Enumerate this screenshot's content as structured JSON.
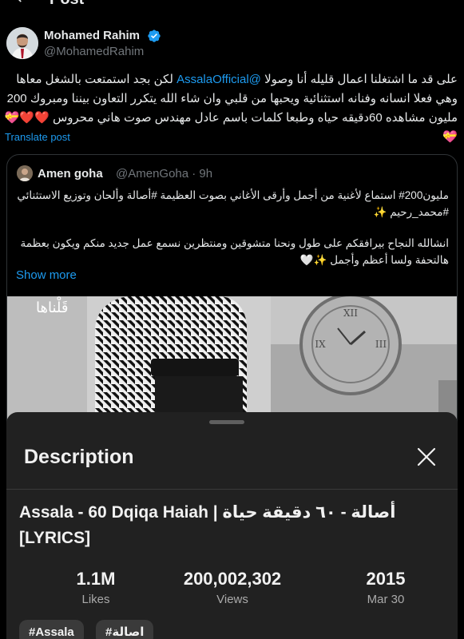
{
  "header": {
    "title": "Post"
  },
  "post": {
    "author_name": "Mohamed Rahim",
    "author_handle": "@MohamedRahim",
    "text_part1": "على قد ما اشتغلنا اعمال قليله أنا وصولا ",
    "mention": "@AssalaOfficial",
    "text_part2": " لكن بجد استمتعت بالشغل معاها وهي فعلا انسانه وفنانه استثنائية ويحبها من قلبي وان شاء الله يتكرر التعاون بيننا ومبروك 200 مليون مشاهده 60دقيقه حياه وطبعا كلمات باسم عادل مهندس صوت هاني محروس ",
    "hearts": "❤️❤️💝💝",
    "translate_label": "Translate post"
  },
  "quote": {
    "author_name": "Amen goha",
    "author_handle": "@AmenGoha · 9h",
    "line1": "مليون200# استماع لأغنية من أجمل وأرقى الأغاني بصوت العظيمة #أصالة وألحان وتوزيع الاستثنائي #محمد_رحيم ✨",
    "line2": "انشالله النجاح بيرافقكم على طول ونحنا متشوقين ومنتظرين نسمع عمل جديد منكم ويكون بعظمة هالتحفة ولسا أعظم وأجمل ✨🤍",
    "show_more": "Show more",
    "media_caption": "قَلْناها"
  },
  "description_sheet": {
    "title": "Description",
    "video_title": "Assala - 60 Dqiqa Haiah | أصالة - ٦٠ دقيقة حياة [LYRICS]",
    "stats": [
      {
        "value": "1.1M",
        "label": "Likes"
      },
      {
        "value": "200,002,302",
        "label": "Views"
      },
      {
        "value": "2015",
        "label": "Mar 30"
      }
    ],
    "tags": [
      "#Assala",
      "#اصالة"
    ]
  },
  "colors": {
    "accent": "#1d9bf0",
    "background": "#000000",
    "sheet_background": "#212121",
    "heart": "#f91880"
  },
  "icons": {
    "back": "arrow-left-icon",
    "verified": "verified-badge-icon",
    "close": "close-icon"
  }
}
